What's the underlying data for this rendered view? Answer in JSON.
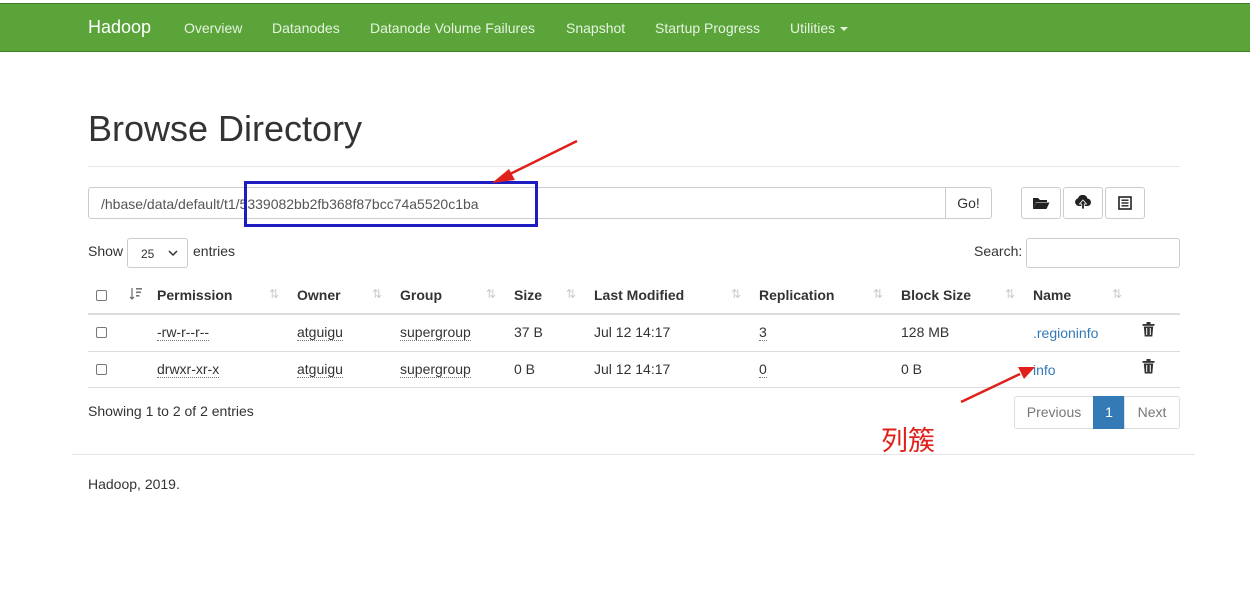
{
  "navbar": {
    "brand": "Hadoop",
    "items": [
      "Overview",
      "Datanodes",
      "Datanode Volume Failures",
      "Snapshot",
      "Startup Progress",
      "Utilities"
    ]
  },
  "page": {
    "title": "Browse Directory"
  },
  "path": {
    "value": "/hbase/data/default/t1/5339082bb2fb368f87bcc74a5520c1ba",
    "go_label": "Go!"
  },
  "toolbar": {
    "icons": [
      "folder-open-icon",
      "upload-icon",
      "list-icon"
    ]
  },
  "controls": {
    "show_label": "Show",
    "page_size": "25",
    "entries_label": "entries",
    "search_label": "Search:"
  },
  "table": {
    "headers": [
      "Permission",
      "Owner",
      "Group",
      "Size",
      "Last Modified",
      "Replication",
      "Block Size",
      "Name"
    ],
    "rows": [
      {
        "permission": "-rw-r--r--",
        "owner": "atguigu",
        "group": "supergroup",
        "size": "37 B",
        "modified": "Jul 12 14:17",
        "replication": "3",
        "block_size": "128 MB",
        "name": ".regioninfo"
      },
      {
        "permission": "drwxr-xr-x",
        "owner": "atguigu",
        "group": "supergroup",
        "size": "0 B",
        "modified": "Jul 12 14:17",
        "replication": "0",
        "block_size": "0 B",
        "name": "info"
      }
    ]
  },
  "pagination": {
    "summary": "Showing 1 to 2 of 2 entries",
    "previous": "Previous",
    "current": "1",
    "next": "Next"
  },
  "footer": {
    "text": "Hadoop, 2019."
  },
  "annotation": {
    "text": "列簇"
  },
  "colors": {
    "navbar": "#5aa43a",
    "link": "#337ab7",
    "highlight": "#1c1cc0",
    "arrow": "#e0211b"
  }
}
